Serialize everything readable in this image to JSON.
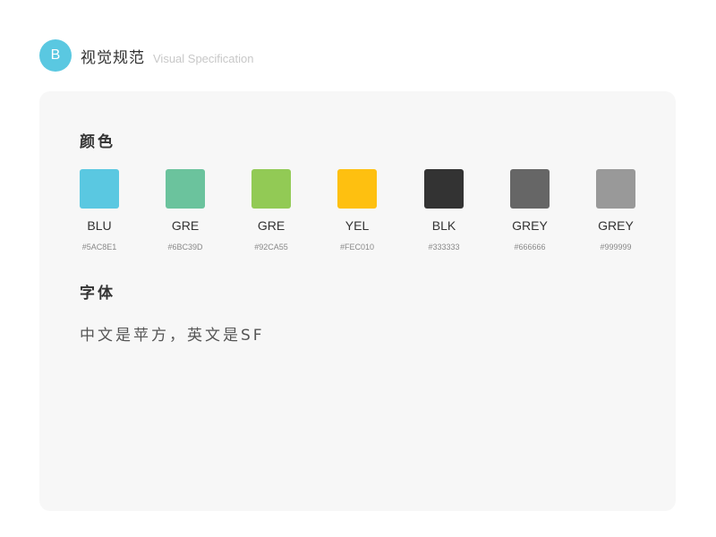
{
  "header": {
    "badge": "B",
    "title": "视觉规范",
    "subtitle": "Visual Specification"
  },
  "colors_section": {
    "title": "颜色",
    "swatches": [
      {
        "name": "BLU",
        "hex": "#5AC8E1",
        "color": "#5AC8E1"
      },
      {
        "name": "GRE",
        "hex": "#6BC39D",
        "color": "#6BC39D"
      },
      {
        "name": "GRE",
        "hex": "#92CA55",
        "color": "#92CA55"
      },
      {
        "name": "YEL",
        "hex": "#FEC010",
        "color": "#FEC010"
      },
      {
        "name": "BLK",
        "hex": "#333333",
        "color": "#333333"
      },
      {
        "name": "GREY",
        "hex": "#666666",
        "color": "#666666"
      },
      {
        "name": "GREY",
        "hex": "#999999",
        "color": "#999999"
      }
    ]
  },
  "font_section": {
    "title": "字体",
    "description": "中文是苹方，英文是SF"
  }
}
